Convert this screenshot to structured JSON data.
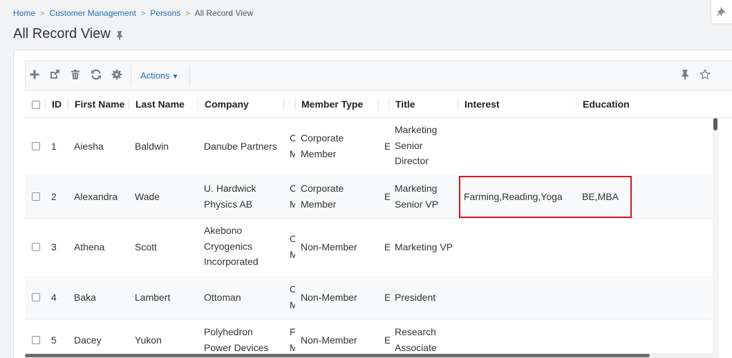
{
  "breadcrumb": {
    "items": [
      "Home",
      "Customer Management",
      "Persons",
      "All Record View"
    ]
  },
  "page": {
    "title": "All Record View"
  },
  "toolbar": {
    "icons": [
      "plus-icon",
      "external-link-icon",
      "trash-icon",
      "refresh-icon",
      "gear-icon",
      "pin-icon",
      "star-icon"
    ],
    "actions_label": "Actions",
    "caret": "▼"
  },
  "columns": {
    "id": "ID",
    "first_name": "First Name",
    "last_name": "Last Name",
    "company": "Company",
    "member_type": "Member Type",
    "title": "Title",
    "interest": "Interest",
    "education": "Education"
  },
  "rows": [
    {
      "id": "1",
      "first_name": "Aiesha",
      "last_name": "Baldwin",
      "company": [
        "Danube Partners"
      ],
      "hidden_a": [
        "C",
        "M"
      ],
      "member_type": [
        "Corporate",
        "Member"
      ],
      "hidden_b": [
        "E"
      ],
      "title": [
        "Marketing",
        "Senior",
        "Director"
      ],
      "interest": "",
      "education": ""
    },
    {
      "id": "2",
      "first_name": "Alexandra",
      "last_name": "Wade",
      "company": [
        "U. Hardwick",
        "Physics AB"
      ],
      "hidden_a": [
        "C",
        "M"
      ],
      "member_type": [
        "Corporate",
        "Member"
      ],
      "hidden_b": [
        "E"
      ],
      "title": [
        "Marketing",
        "Senior VP"
      ],
      "interest": "Farming,Reading,Yoga",
      "education": "BE,MBA"
    },
    {
      "id": "3",
      "first_name": "Athena",
      "last_name": "Scott",
      "company": [
        "Akebono",
        "Cryogenics",
        "Incorporated"
      ],
      "hidden_a": [
        "C",
        "M"
      ],
      "member_type": [
        "Non-Member"
      ],
      "hidden_b": [
        "E"
      ],
      "title": [
        "Marketing VP"
      ],
      "interest": "",
      "education": ""
    },
    {
      "id": "4",
      "first_name": "Baka",
      "last_name": "Lambert",
      "company": [
        "Ottoman"
      ],
      "hidden_a": [
        "C",
        "M"
      ],
      "member_type": [
        "Non-Member"
      ],
      "hidden_b": [
        "E"
      ],
      "title": [
        "President"
      ],
      "interest": "",
      "education": ""
    },
    {
      "id": "5",
      "first_name": "Dacey",
      "last_name": "Yukon",
      "company": [
        "Polyhedron",
        "Power Devices"
      ],
      "hidden_a": [
        "F",
        "M"
      ],
      "member_type": [
        "Non-Member"
      ],
      "hidden_b": [
        "E"
      ],
      "title": [
        "Research",
        "Associate"
      ],
      "interest": "",
      "education": ""
    }
  ],
  "colors": {
    "link": "#1f6fb8",
    "highlight": "#e0101a",
    "icon": "#7a7f85"
  }
}
